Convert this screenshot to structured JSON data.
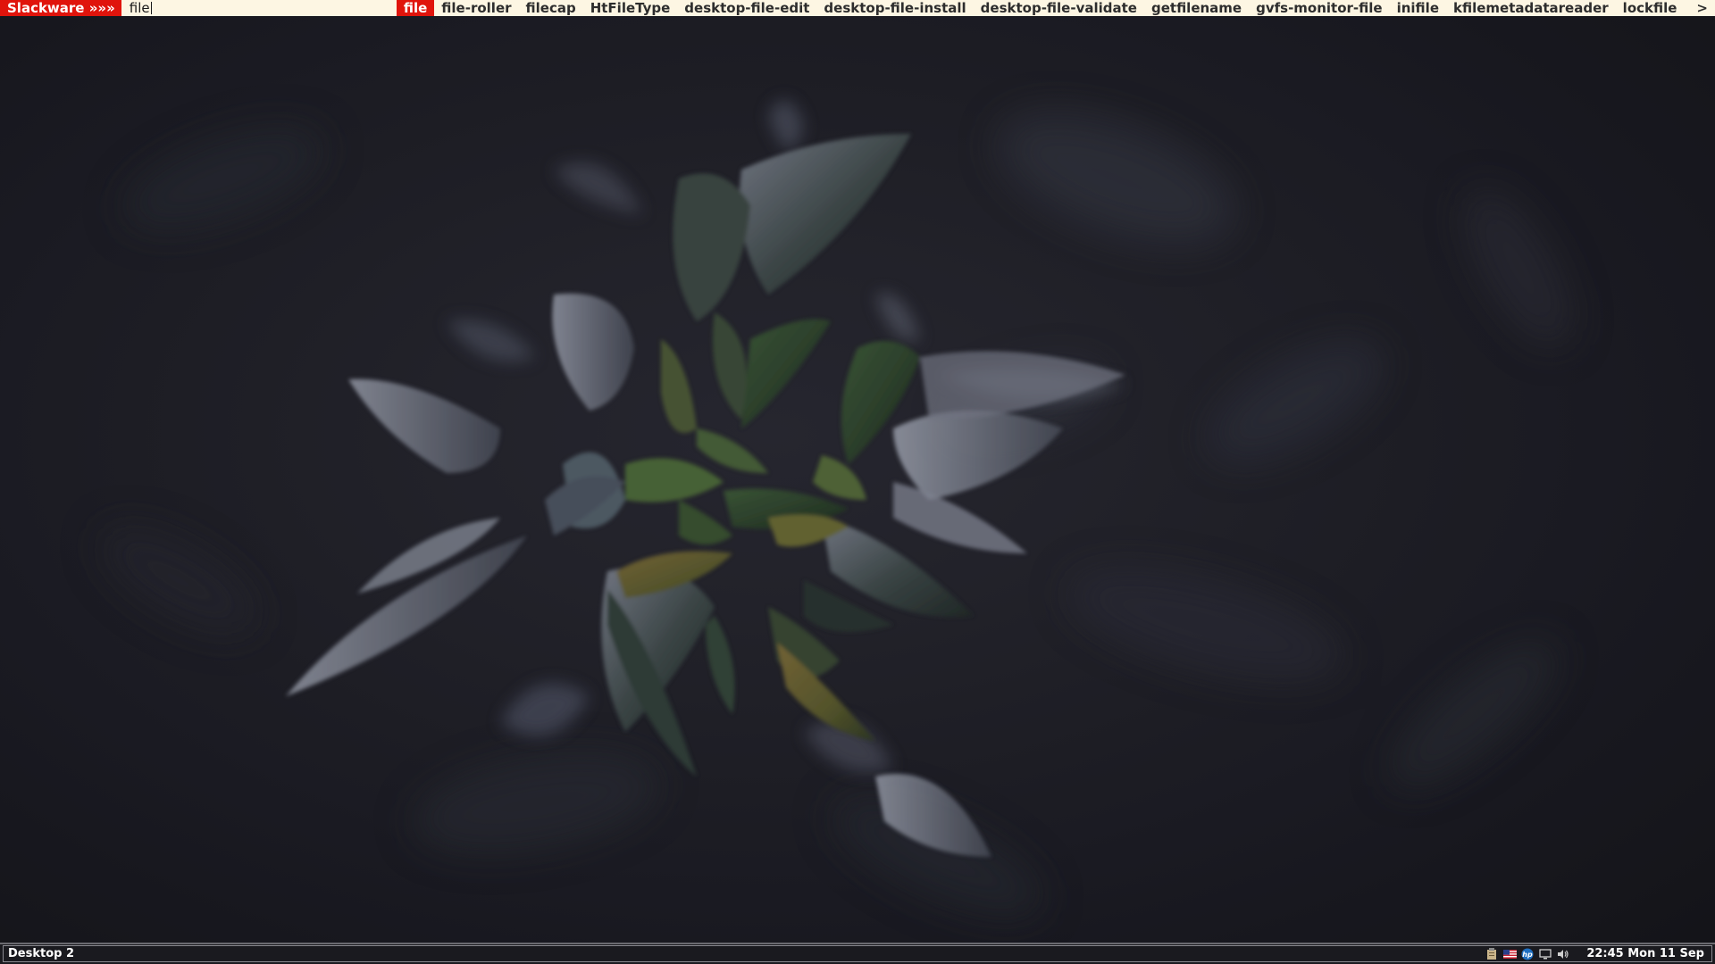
{
  "dmenu": {
    "prompt": "Slackware »»»",
    "input_value": "file",
    "items": [
      {
        "label": "file",
        "selected": true
      },
      {
        "label": "file-roller",
        "selected": false
      },
      {
        "label": "filecap",
        "selected": false
      },
      {
        "label": "HtFileType",
        "selected": false
      },
      {
        "label": "desktop-file-edit",
        "selected": false
      },
      {
        "label": "desktop-file-install",
        "selected": false
      },
      {
        "label": "desktop-file-validate",
        "selected": false
      },
      {
        "label": "getfilename",
        "selected": false
      },
      {
        "label": "gvfs-monitor-file",
        "selected": false
      },
      {
        "label": "inifile",
        "selected": false
      },
      {
        "label": "kfilemetadatareader",
        "selected": false
      },
      {
        "label": "lockfile",
        "selected": false
      }
    ],
    "more_indicator": ">",
    "colors": {
      "background": "#fdf6e3",
      "accent": "#e0140c"
    }
  },
  "panel": {
    "desktop_label": "Desktop 2",
    "tray_icons": [
      "clipboard-icon",
      "keyboard-layout-us-flag-icon",
      "hp-printer-icon",
      "network-monitor-icon",
      "volume-icon"
    ],
    "clock": "22:45 Mon 11 Sep"
  }
}
